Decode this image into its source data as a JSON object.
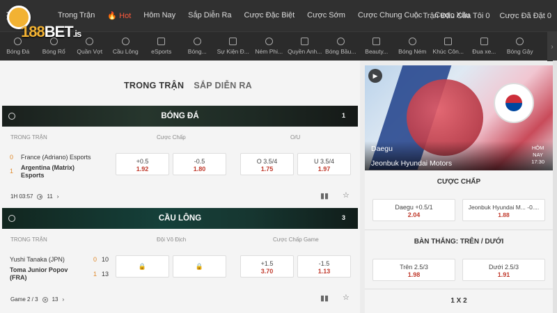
{
  "logo": {
    "brand_a": "188",
    "brand_b": "BET",
    "suffix": ".is"
  },
  "topnav": {
    "items": [
      "Trong Trận",
      "Hot",
      "Hôm Nay",
      "Sắp Diễn Ra",
      "Cược Đặc Biệt",
      "Cược Sớm",
      "Cược Chung Cuộc",
      "Cược Xâu"
    ],
    "right": [
      "Trận Đấu Của Tôi 0",
      "Cược Đã Đặt 0"
    ]
  },
  "sports": [
    "Bóng Đá",
    "Bóng Rổ",
    "Quần Vợt",
    "Cầu Lông",
    "eSports",
    "Bóng...",
    "Sự Kiện Đ...",
    "Ném Phi...",
    "Quyền Anh...",
    "Bóng Bầu...",
    "Beauty...",
    "Bóng Ném",
    "Khúc Côn...",
    "Đua xe...",
    "Bóng Gậy"
  ],
  "tabs": {
    "active": "TRONG TRẬN",
    "inactive": "SẮP DIỄN RA"
  },
  "football": {
    "title": "BÓNG ĐÁ",
    "count": "1",
    "col_live": "TRONG TRẬN",
    "col_hdp": "Cược Chấp",
    "col_ou": "O/U",
    "team1": "France (Adriano) Esports",
    "team2_l1": "Argentina (Matrix)",
    "team2_l2": "Esports",
    "score1": "0",
    "score2": "1",
    "odds": [
      {
        "t": "+0.5",
        "v": "1.92"
      },
      {
        "t": "-0.5",
        "v": "1.80"
      },
      {
        "t": "O 3.5/4",
        "v": "1.75"
      },
      {
        "t": "U 3.5/4",
        "v": "1.97"
      }
    ],
    "time": "1H 03:57",
    "markets": "11"
  },
  "badminton": {
    "title": "CẦU LÔNG",
    "count": "3",
    "col_live": "TRONG TRẬN",
    "col_win": "Đội Vô Địch",
    "col_hdp": "Cược Chấp Game",
    "team1": "Yushi Tanaka (JPN)",
    "team2_l1": "Toma Junior Popov",
    "team2_l2": "(FRA)",
    "s1a": "0",
    "s1b": "10",
    "s2a": "1",
    "s2b": "13",
    "lock": "🔒",
    "odds": [
      {
        "t": "+1.5",
        "v": "3.70"
      },
      {
        "t": "-1.5",
        "v": "1.13"
      }
    ],
    "game": "Game 2 / 3",
    "markets": "13"
  },
  "side": {
    "banner_t1": "Daegu",
    "banner_t2": "Jeonbuk Hyundai Motors",
    "when_l1": "HÔM",
    "when_l2": "NAY",
    "when_l3": "17:30",
    "hdp_title": "CƯỢC CHẤP",
    "hdp": [
      {
        "t": "Daegu +0.5/1",
        "v": "2.04"
      },
      {
        "t": "Jeonbuk Hyundai M... -0....",
        "v": "1.88"
      }
    ],
    "ou_title": "BÀN THẮNG: TRÊN / DƯỚI",
    "ou": [
      {
        "t": "Trên 2.5/3",
        "v": "1.98"
      },
      {
        "t": "Dưới 2.5/3",
        "v": "1.91"
      }
    ],
    "x12_title": "1 X 2"
  },
  "colors": {
    "accent": "#f2b233",
    "odd_value": "#c0392b",
    "score": "#e0892a",
    "hot": "#ff5a3c"
  }
}
